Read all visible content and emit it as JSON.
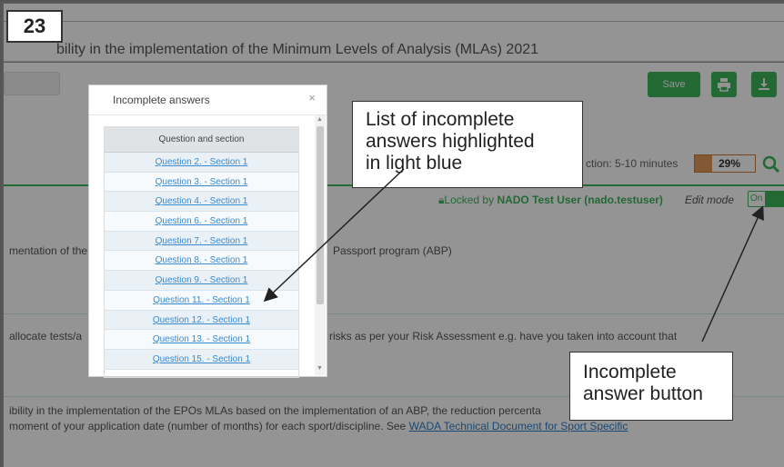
{
  "slide_number": "23",
  "title": "bility in the implementation of the Minimum Levels of Analysis (MLAs) 2021",
  "toolbar": {
    "save_label": "Save",
    "print_icon": "printer-icon",
    "download_icon": "download-icon"
  },
  "estimate": {
    "text": "ction: 5-10 minutes",
    "progress_value": "29%",
    "progress_fraction": 0.29
  },
  "lock": {
    "prefix": "Locked by ",
    "user": "NADO Test User (nado.testuser)",
    "edit_mode_label": "Edit mode",
    "toggle_label": "On"
  },
  "page_text": {
    "line1_left": "mentation of the",
    "line1_right": "Passport program (ABP)",
    "line2_left": "allocate tests/a",
    "line2_right": "risks as per your Risk Assessment e.g. have you taken into account that",
    "para_line1": "ibility in the implementation of the EPOs MLAs based on the implementation of an ABP, the reduction percenta",
    "para_line2": "moment of your application date (number of months) for each sport/discipline. See ",
    "para_link": "WADA Technical Document for Sport Specific"
  },
  "modal": {
    "title": "Incomplete answers",
    "close_label": "×",
    "column_header": "Question and section",
    "rows": [
      "Question 2. - Section 1",
      "Question 3. - Section 1",
      "Question 4. - Section 1",
      "Question 6. - Section 1",
      "Question 7. - Section 1",
      "Question 8. - Section 1",
      "Question 9. - Section 1",
      "Question 11. - Section 1",
      "Question 12. - Section 1",
      "Question 13. - Section 1",
      "Question 15. - Section 1"
    ]
  },
  "callouts": {
    "list_note": [
      "List of incomplete",
      "answers highlighted",
      "in light blue"
    ],
    "button_note": [
      "Incomplete",
      "answer button"
    ]
  },
  "colors": {
    "accent_green": "#3bb55a",
    "progress_orange": "#e09a5a",
    "link_blue": "#3b8ad0"
  }
}
